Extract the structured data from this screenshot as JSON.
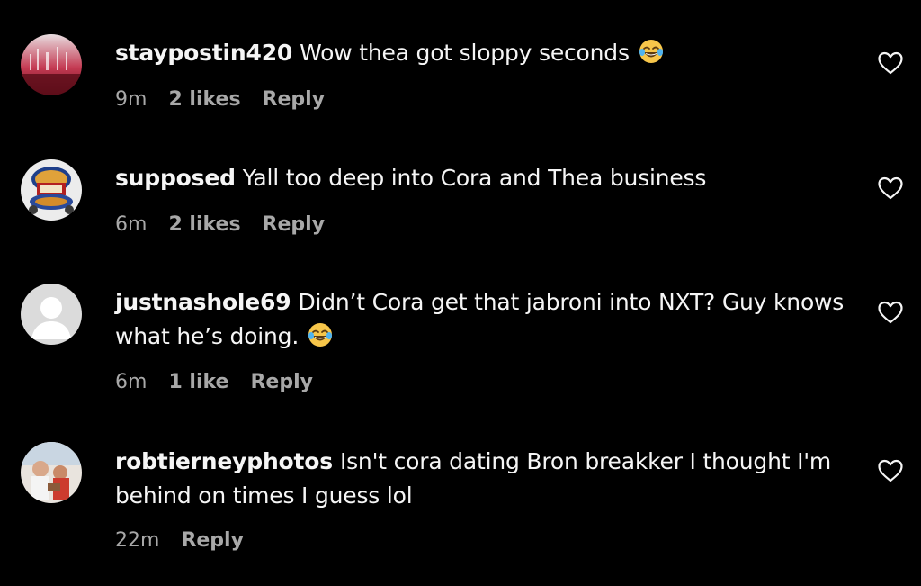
{
  "colors": {
    "background": "#000000",
    "text": "#f5f5f5",
    "meta": "#a8a8a8"
  },
  "comments": [
    {
      "username": "staypostin420",
      "text": "Wow thea got sloppy seconds",
      "emoji": "face-with-tears-of-joy",
      "time": "9m",
      "likes": "2 likes",
      "reply": "Reply"
    },
    {
      "username": "supposed",
      "text": "Yall too deep into Cora and Thea business",
      "time": "6m",
      "likes": "2 likes",
      "reply": "Reply"
    },
    {
      "username": "justnashole69",
      "text": "Didn’t Cora get that jabroni into NXT? Guy knows what he’s doing.",
      "emoji": "face-with-tears-of-joy",
      "time": "6m",
      "likes": "1 like",
      "reply": "Reply"
    },
    {
      "username": "robtierneyphotos",
      "text": "Isn't cora dating Bron breakker I thought I'm behind on times I guess lol",
      "time": "22m",
      "reply": "Reply"
    }
  ],
  "icons": {
    "like": "heart-outline-icon",
    "emoji": "face-with-tears-of-joy"
  }
}
